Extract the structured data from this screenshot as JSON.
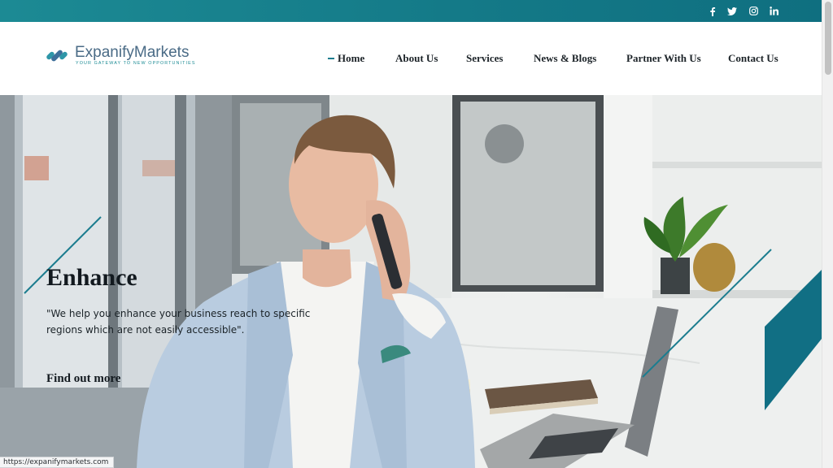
{
  "brand": {
    "name": "ExpanifyMarkets",
    "tagline": "YOUR GATEWAY TO NEW OPPORTUNITIES",
    "colors": {
      "teal": "#1c8a94",
      "navy": "#4a6b86"
    }
  },
  "social": [
    {
      "icon": "facebook-icon"
    },
    {
      "icon": "twitter-icon"
    },
    {
      "icon": "instagram-icon"
    },
    {
      "icon": "linkedin-icon"
    }
  ],
  "nav": {
    "active": "Home",
    "items": [
      {
        "label": "Home"
      },
      {
        "label": "About Us"
      },
      {
        "label": "Services"
      },
      {
        "label": "News & Blogs"
      },
      {
        "label": "Partner With Us"
      },
      {
        "label": "Contact Us"
      }
    ]
  },
  "hero": {
    "title": "Enhance",
    "text": "\"We help you enhance your business reach to specific regions which are not easily accessible\".",
    "link": "Find out more"
  },
  "status_bar": {
    "url": "https://expanifymarkets.com"
  }
}
